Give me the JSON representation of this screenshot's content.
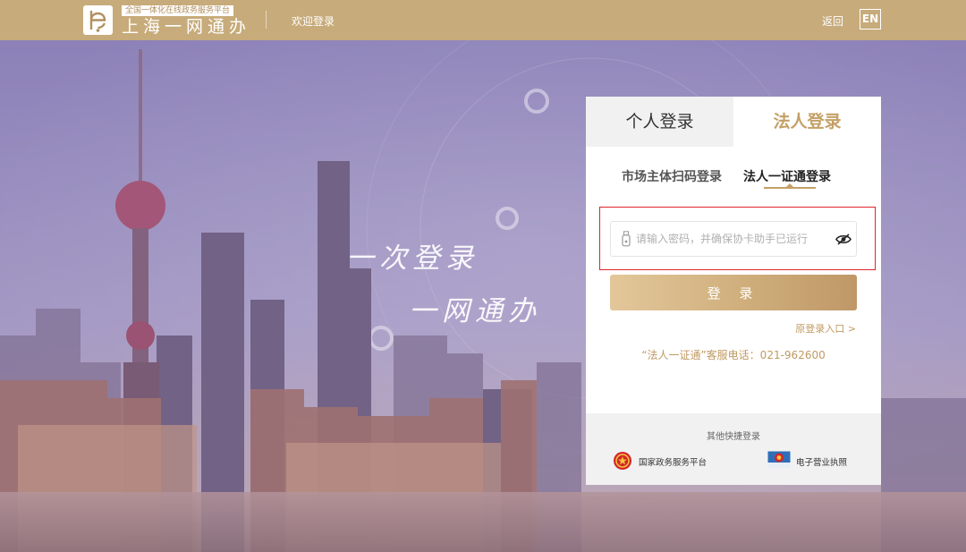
{
  "header": {
    "slogan": "全国一体化在线政务服务平台",
    "brand": "上海一网通办",
    "welcome": "欢迎登录",
    "back": "返回",
    "lang": "EN"
  },
  "hero": {
    "line1": "一次登录",
    "line2": "一网通办"
  },
  "login": {
    "tabs": [
      {
        "label": "个人登录",
        "active": false
      },
      {
        "label": "法人登录",
        "active": true
      }
    ],
    "subtabs": [
      {
        "label": "市场主体扫码登录",
        "active": false
      },
      {
        "label": "法人一证通登录",
        "active": true
      }
    ],
    "password": {
      "value": "",
      "placeholder": "请输入密码，并确保协卡助手已运行"
    },
    "submit_label": "登 录",
    "old_entry": "原登录入口 >",
    "hotline": "“法人一证通”客服电话：021-962600",
    "quick": {
      "title": "其他快捷登录",
      "items": [
        {
          "label": "国家政务服务平台",
          "icon": "national-emblem-icon"
        },
        {
          "label": "电子营业执照",
          "icon": "business-license-icon"
        }
      ]
    }
  },
  "colors": {
    "brand_gold": "#c7ab7a",
    "accent": "#c4a066",
    "highlight": "#e0242b"
  }
}
